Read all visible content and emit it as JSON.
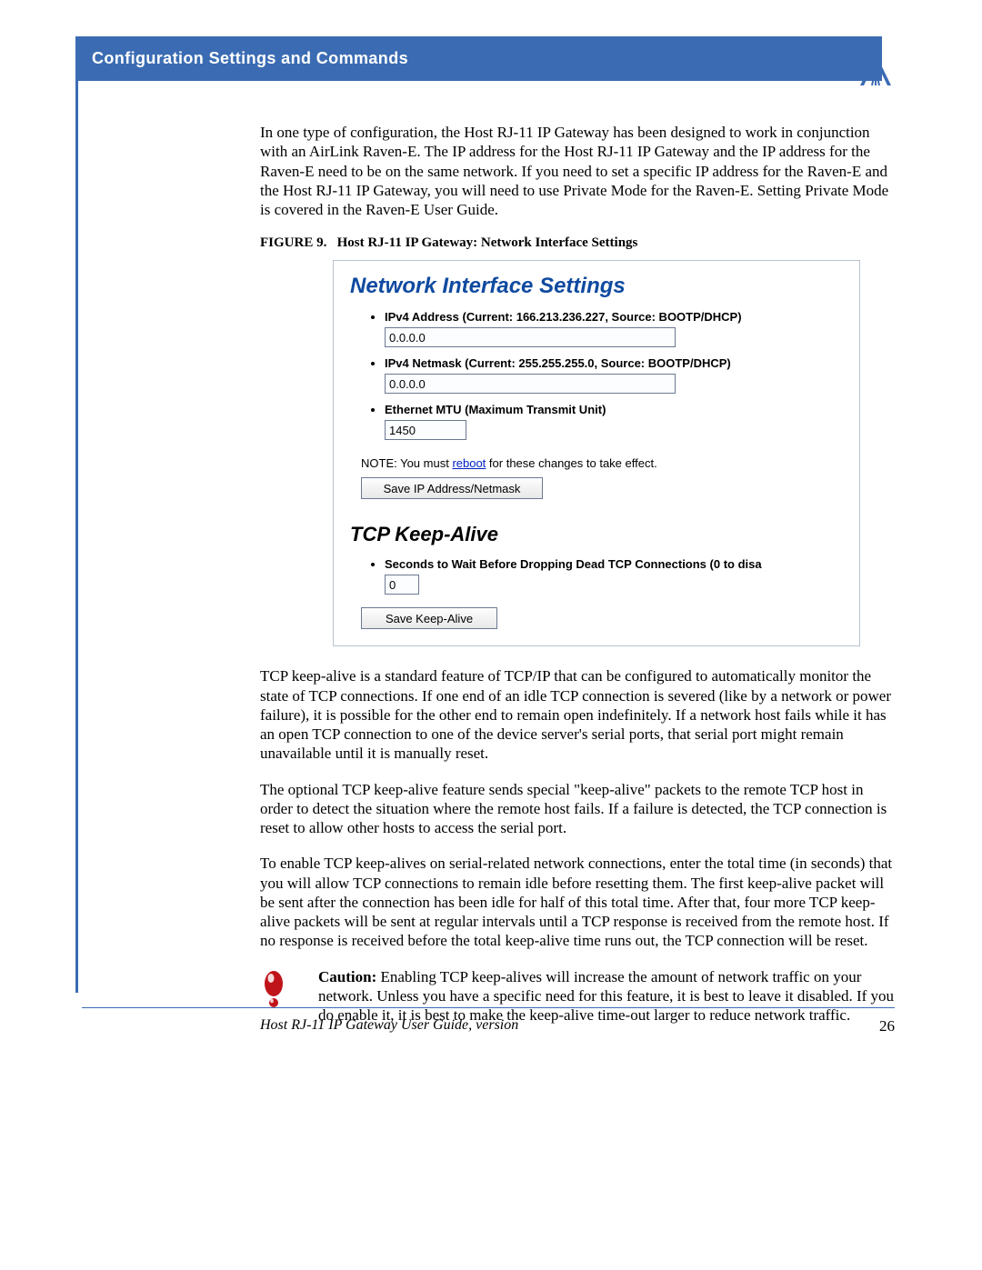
{
  "header": {
    "title": "Configuration Settings and Commands"
  },
  "intro": "In one type of configuration, the Host RJ-11 IP Gateway has been designed to work in conjunction with an AirLink Raven-E. The IP address for the Host RJ-11 IP Gateway and the IP address for the Raven-E need to be on the same network. If you need to set a specific IP address for the Raven-E and the Host RJ-11 IP Gateway, you will need to use Private Mode for the Raven-E. Setting Private Mode is covered in the Raven-E User Guide.",
  "figure": {
    "caption_label": "FIGURE 9.",
    "caption_text": "Host RJ-11 IP Gateway: Network Interface Settings",
    "net_heading": "Network Interface Settings",
    "ipv4_addr_label": "IPv4 Address (Current: 166.213.236.227, Source: BOOTP/DHCP)",
    "ipv4_addr_value": "0.0.0.0",
    "ipv4_mask_label": "IPv4 Netmask (Current: 255.255.255.0, Source: BOOTP/DHCP)",
    "ipv4_mask_value": "0.0.0.0",
    "mtu_label": "Ethernet MTU (Maximum Transmit Unit)",
    "mtu_value": "1450",
    "note_prefix": "NOTE: You must ",
    "note_link": "reboot",
    "note_suffix": " for these changes to take effect.",
    "save_ip_btn": "Save IP Address/Netmask",
    "ka_heading": "TCP Keep-Alive",
    "ka_label": "Seconds to Wait Before Dropping Dead TCP Connections (0 to disa",
    "ka_value": "0",
    "save_ka_btn": "Save Keep-Alive"
  },
  "para_tcp1": "TCP keep-alive is a standard feature of TCP/IP that can be configured to automatically monitor the state of TCP connections. If one end of an idle TCP connection is severed (like by a network or power failure), it is possible for the other end to remain open indefinitely. If a network host fails while it has an open TCP connection to one of the device server's serial ports, that serial port might remain unavailable until it is manually reset.",
  "para_tcp2": "The optional TCP keep-alive feature sends special \"keep-alive\" packets to the remote TCP host in order to detect the situation where the remote host fails. If a failure is detected, the TCP connection is reset to allow other hosts to access the serial port.",
  "para_tcp3": "To enable TCP keep-alives on serial-related network connections, enter the total time (in seconds) that you will allow TCP connections to remain idle before resetting them. The first keep-alive packet will be sent after the connection has been idle for half of this total time. After that, four more TCP keep-alive packets will be sent at regular intervals until a TCP response is received from the remote host. If no response is received before the total keep-alive time runs out, the TCP connection will be reset.",
  "caution": {
    "label": "Caution:",
    "text": " Enabling TCP keep-alives will increase the amount of network traffic on your network. Unless you have a specific need for this feature, it is best to leave it disabled. If you do enable it, it is best to make the keep-alive time-out larger to reduce network traffic."
  },
  "footer": {
    "title": "Host RJ-11 IP Gateway User Guide, version",
    "page": "26"
  }
}
